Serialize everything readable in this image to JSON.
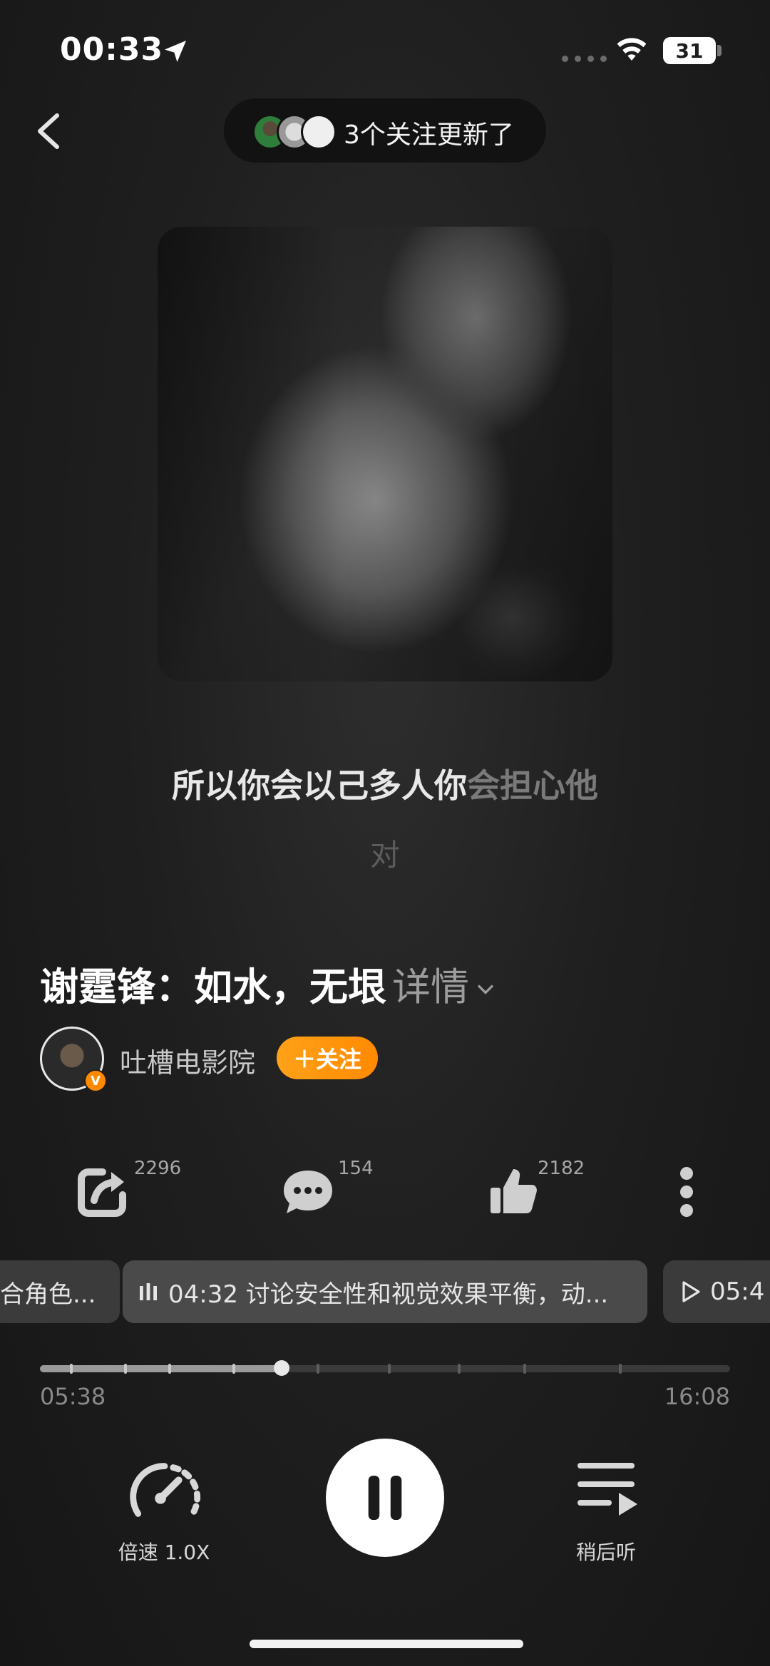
{
  "status_bar": {
    "time": "00:33",
    "battery": "31"
  },
  "header": {
    "follow_update_text": "3个关注更新了"
  },
  "lyrics": {
    "line1_active": "所以你会以己多人你",
    "line1_rest": "会担心他",
    "line2": "对"
  },
  "episode": {
    "title": "谢霆锋：如水，无垠",
    "detail_label": "详情"
  },
  "author": {
    "name": "吐槽电影院",
    "verified_badge": "V",
    "follow_label": "＋关注"
  },
  "actions": {
    "share_count": "2296",
    "comment_count": "154",
    "like_count": "2182"
  },
  "chapters": {
    "prev": "合角色...",
    "current": "04:32 讨论安全性和视觉效果平衡，动...",
    "next": "05:4"
  },
  "progress": {
    "current_time": "05:38",
    "total_time": "16:08",
    "fraction": 0.35
  },
  "controls": {
    "speed_label": "倍速 1.0X",
    "listen_later_label": "稍后听"
  },
  "colors": {
    "accent": "#ff8a00",
    "background": "#1f1f1f"
  },
  "icons": [
    "location-arrow-icon",
    "wifi-icon",
    "back-chevron-icon",
    "share-icon",
    "comment-icon",
    "like-icon",
    "more-icon",
    "speedometer-icon",
    "pause-icon",
    "playlist-later-icon",
    "playing-bars-icon",
    "play-icon"
  ]
}
